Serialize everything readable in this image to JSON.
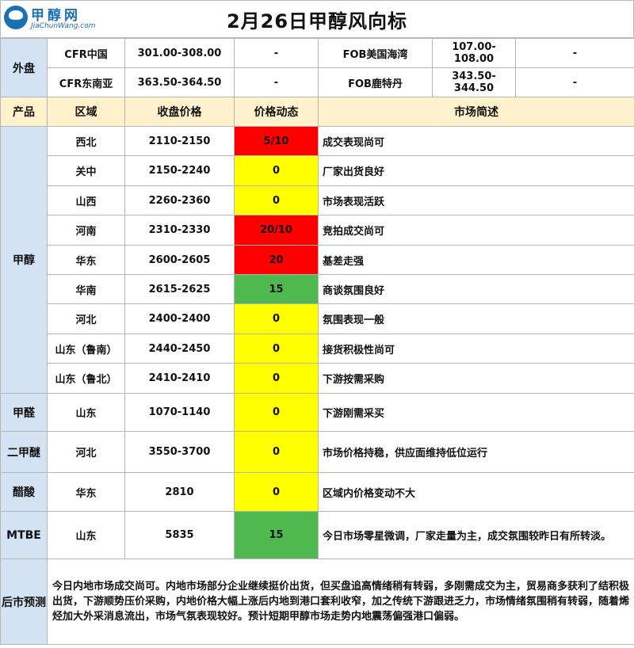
{
  "title": "2月26日甲醇风向标",
  "logo": {
    "name_cn": "甲醇网",
    "name_en": "JiaChunWang.com",
    "icon": "globe-icon"
  },
  "colors": {
    "header_bg": "#fff2cc",
    "side_bg": "#d3e3f4",
    "red": "#ff0000",
    "yellow": "#ffff00",
    "green": "#4fb84f"
  },
  "external": {
    "label": "外盘",
    "rows": [
      {
        "name1": "CFR中国",
        "price1": "301.00-308.00",
        "change1": "-",
        "name2": "FOB美国海湾",
        "price2": "107.00-108.00",
        "change2": "-"
      },
      {
        "name1": "CFR东南亚",
        "price1": "363.50-364.50",
        "change1": "-",
        "name2": "FOB鹿特丹",
        "price2": "343.50-344.50",
        "change2": "-"
      }
    ]
  },
  "headers": {
    "product": "产品",
    "region": "区域",
    "price": "收盘价格",
    "dynamic": "价格动态",
    "desc": "市场简述"
  },
  "methanol": {
    "label": "甲醇",
    "rows": [
      {
        "region": "西北",
        "price": "2110-2150",
        "dynamic": "5/10",
        "color": "red",
        "desc": "成交表现尚可"
      },
      {
        "region": "关中",
        "price": "2150-2240",
        "dynamic": "0",
        "color": "yellow",
        "desc": "厂家出货良好"
      },
      {
        "region": "山西",
        "price": "2260-2360",
        "dynamic": "0",
        "color": "yellow",
        "desc": "市场表现活跃"
      },
      {
        "region": "河南",
        "price": "2310-2330",
        "dynamic": "20/10",
        "color": "red",
        "desc": "竞拍成交尚可"
      },
      {
        "region": "华东",
        "price": "2600-2605",
        "dynamic": "20",
        "color": "red",
        "desc": "基差走强"
      },
      {
        "region": "华南",
        "price": "2615-2625",
        "dynamic": "15",
        "color": "green",
        "desc": "商谈氛围良好"
      },
      {
        "region": "河北",
        "price": "2400-2400",
        "dynamic": "0",
        "color": "yellow",
        "desc": "氛围表现一般"
      },
      {
        "region": "山东（鲁南）",
        "price": "2440-2450",
        "dynamic": "0",
        "color": "yellow",
        "desc": "接货积极性尚可"
      },
      {
        "region": "山东（鲁北）",
        "price": "2410-2410",
        "dynamic": "0",
        "color": "yellow",
        "desc": "下游按需采购"
      }
    ]
  },
  "others": [
    {
      "product": "甲醛",
      "region": "山东",
      "price": "1070-1140",
      "dynamic": "0",
      "color": "yellow",
      "desc": "下游刚需采买"
    },
    {
      "product": "二甲醚",
      "region": "河北",
      "price": "3550-3700",
      "dynamic": "0",
      "color": "yellow",
      "desc": "市场价格持稳，供应面维持低位运行"
    },
    {
      "product": "醋酸",
      "region": "华东",
      "price": "2810",
      "dynamic": "0",
      "color": "yellow",
      "desc": "区域内价格变动不大"
    },
    {
      "product": "MTBE",
      "region": "山东",
      "price": "5835",
      "dynamic": "15",
      "color": "green",
      "desc": "今日市场零星微调，厂家走量为主，成交氛围较昨日有所转淡。"
    }
  ],
  "forecast": {
    "label": "后市预测",
    "text": "今日内地市场成交尚可。内地市场部分企业继续挺价出货，但买盘追高情绪稍有转弱，多刚需成交为主，贸易商多获利了结积极出货，下游顺势压价采购，内地价格大幅上涨后内地到港口套利收窄，加之传统下游跟进乏力，市场情绪氛围稍有转弱，随着烯烃加大外采消息流出，市场气氛表现较好。预计短期甲醇市场走势内地震荡偏强港口偏弱。"
  }
}
